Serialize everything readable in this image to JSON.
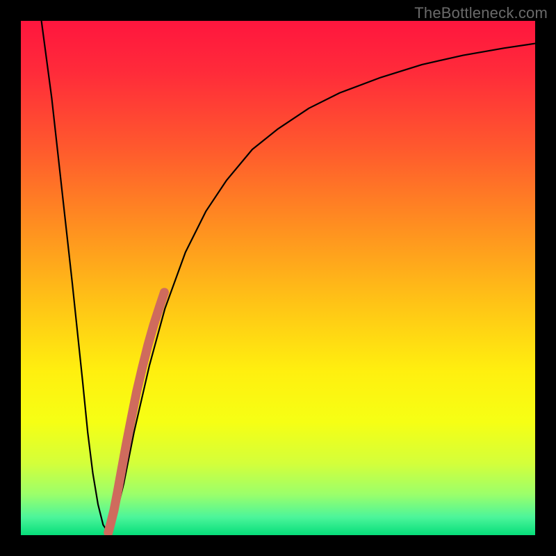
{
  "watermark": "TheBottleneck.com",
  "gradient": {
    "stops": [
      {
        "offset": 0.0,
        "color": "#ff163e"
      },
      {
        "offset": 0.1,
        "color": "#ff2b3a"
      },
      {
        "offset": 0.25,
        "color": "#ff5a2d"
      },
      {
        "offset": 0.4,
        "color": "#ff8f20"
      },
      {
        "offset": 0.55,
        "color": "#ffc416"
      },
      {
        "offset": 0.68,
        "color": "#ffef0f"
      },
      {
        "offset": 0.78,
        "color": "#f6ff14"
      },
      {
        "offset": 0.86,
        "color": "#d4ff3a"
      },
      {
        "offset": 0.92,
        "color": "#9cff6a"
      },
      {
        "offset": 0.965,
        "color": "#4cf59a"
      },
      {
        "offset": 1.0,
        "color": "#06de7a"
      }
    ]
  },
  "chart_data": {
    "type": "line",
    "title": "",
    "xlabel": "",
    "ylabel": "",
    "xlim": [
      0,
      100
    ],
    "ylim": [
      0,
      100
    ],
    "curve": {
      "name": "bottleneck-curve",
      "x": [
        4,
        6,
        8,
        10,
        12,
        13,
        14,
        15,
        16,
        17,
        18,
        20,
        22,
        25,
        28,
        32,
        36,
        40,
        45,
        50,
        56,
        62,
        70,
        78,
        86,
        94,
        100
      ],
      "y": [
        100,
        85,
        67,
        49,
        30,
        20,
        12,
        6,
        2,
        0.5,
        2,
        10,
        20,
        33,
        44,
        55,
        63,
        69,
        75,
        79,
        83,
        86,
        89,
        91.5,
        93.3,
        94.7,
        95.6
      ]
    },
    "highlight": {
      "name": "highlighted-segment",
      "color": "#cf6b5d",
      "x": [
        17.0,
        17.4,
        18.1,
        18.8,
        19.6,
        20.5,
        21.5,
        22.5,
        23.6,
        24.7,
        25.8,
        26.9,
        27.9
      ],
      "y": [
        0.5,
        2.0,
        4.8,
        8.4,
        12.8,
        17.7,
        22.8,
        27.8,
        32.5,
        36.9,
        40.8,
        44.2,
        47.2
      ]
    },
    "minimum": {
      "x": 17.0,
      "y": 0.0
    }
  }
}
